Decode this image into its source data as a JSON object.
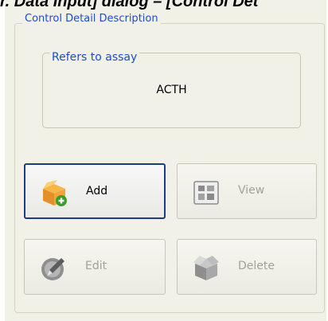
{
  "header": {
    "caption": "r. Data Input] dialog – [Control Det"
  },
  "group": {
    "title": "Control Detail Description",
    "assay_label": "Refers to assay",
    "assay_value": "ACTH"
  },
  "buttons": {
    "add": "Add",
    "view": "View",
    "edit": "Edit",
    "delete": "Delete"
  },
  "icons": {
    "add": "add-box-icon",
    "view": "view-grid-icon",
    "edit": "edit-pen-icon",
    "delete": "delete-box-icon"
  }
}
